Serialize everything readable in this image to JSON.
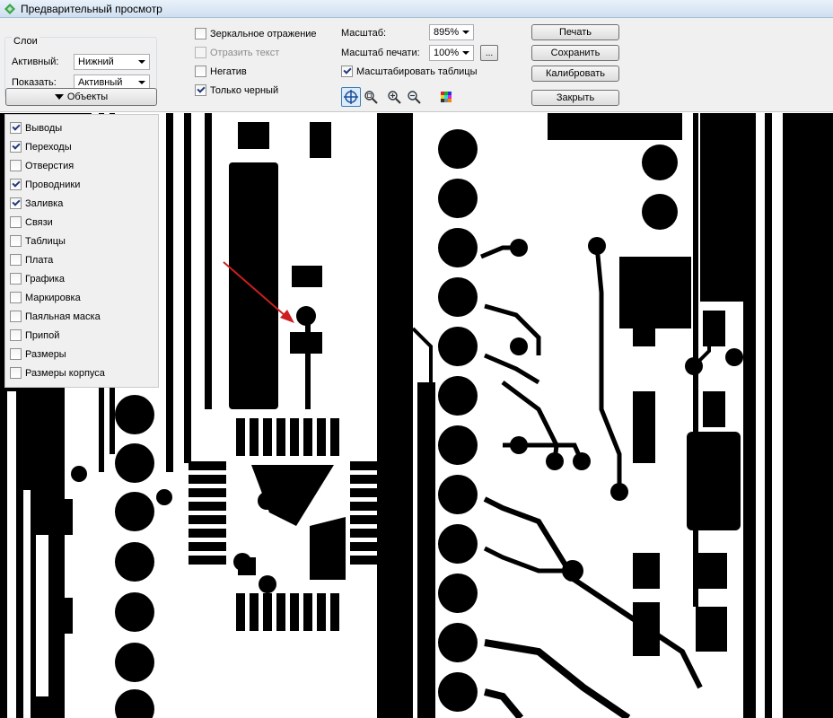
{
  "window": {
    "title": "Предварительный просмотр"
  },
  "layers": {
    "group_title": "Слои",
    "active_label": "Активный:",
    "active_value": "Нижний",
    "show_label": "Показать:",
    "show_value": "Активный"
  },
  "objects_button": {
    "label": "Объекты"
  },
  "options": {
    "mirror": {
      "label": "Зеркальное отражение",
      "checked": false
    },
    "mirror_text": {
      "label": "Отразить текст",
      "checked": false,
      "disabled": true
    },
    "negative": {
      "label": "Негатив",
      "checked": false
    },
    "black_only": {
      "label": "Только черный",
      "checked": true
    }
  },
  "scale": {
    "label": "Масштаб:",
    "value": "895%",
    "print_label": "Масштаб печати:",
    "print_value": "100%",
    "ellipsis": "...",
    "scale_tables": {
      "label": "Масштабировать таблицы",
      "checked": true
    }
  },
  "buttons": {
    "print": "Печать",
    "save": "Сохранить",
    "calibrate": "Калибровать",
    "close": "Закрыть"
  },
  "tools": [
    {
      "name": "pan-tool-icon",
      "active": true
    },
    {
      "name": "zoom-window-icon",
      "active": false
    },
    {
      "name": "zoom-in-icon",
      "active": false
    },
    {
      "name": "zoom-out-icon",
      "active": false
    },
    {
      "name": "color-palette-icon",
      "active": false
    }
  ],
  "objects": [
    {
      "label": "Выводы",
      "checked": true
    },
    {
      "label": "Переходы",
      "checked": true
    },
    {
      "label": "Отверстия",
      "checked": false
    },
    {
      "label": "Проводники",
      "checked": true
    },
    {
      "label": "Заливка",
      "checked": true
    },
    {
      "label": "Связи",
      "checked": false
    },
    {
      "label": "Таблицы",
      "checked": false
    },
    {
      "label": "Плата",
      "checked": false
    },
    {
      "label": "Графика",
      "checked": false
    },
    {
      "label": "Маркировка",
      "checked": false
    },
    {
      "label": "Паяльная маска",
      "checked": false
    },
    {
      "label": "Припой",
      "checked": false
    },
    {
      "label": "Размеры",
      "checked": false
    },
    {
      "label": "Размеры корпуса",
      "checked": false
    }
  ],
  "colors": {
    "trace": "#000000",
    "board": "#ffffff",
    "arrow": "#cc1f1f",
    "panel": "#f0f0f0"
  }
}
